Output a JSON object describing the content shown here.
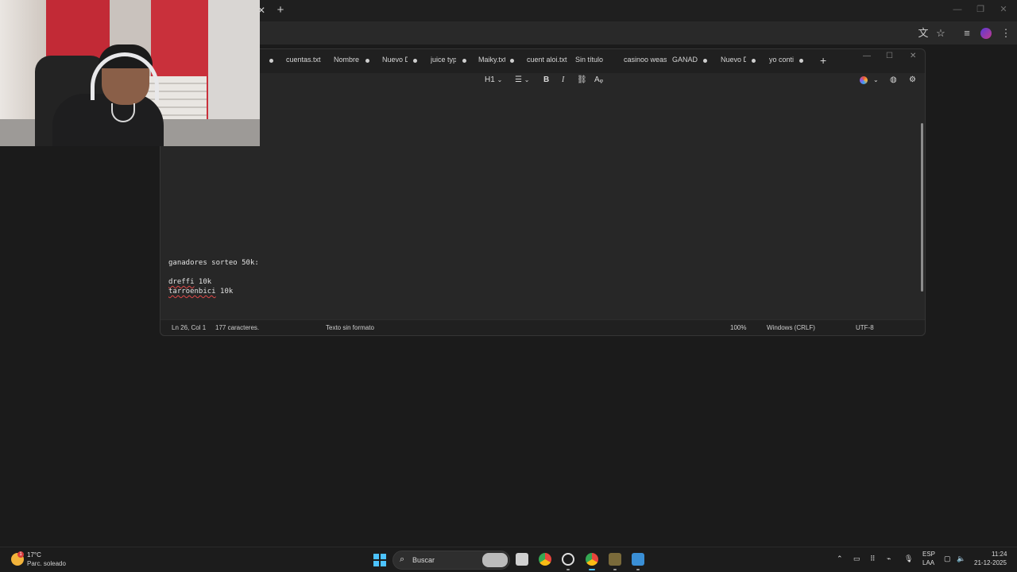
{
  "browser": {
    "new_tab_glyph": "+",
    "close_glyph": "✕"
  },
  "notepad": {
    "tabs": [
      {
        "label": "cuentas.txt",
        "modified": false
      },
      {
        "label": "Nombre",
        "modified": true
      },
      {
        "label": "Nuevo D",
        "modified": true
      },
      {
        "label": "juice typ",
        "modified": true
      },
      {
        "label": "Maiky.txt",
        "modified": true
      },
      {
        "label": "cuent aloi.txt",
        "modified": false
      },
      {
        "label": "Sin título",
        "modified": false
      },
      {
        "label": "casinoo weas.t",
        "modified": false
      },
      {
        "label": "GANADO",
        "modified": true
      },
      {
        "label": "Nuevo D",
        "modified": true
      },
      {
        "label": "yo conti",
        "modified": true
      }
    ],
    "add_tab_glyph": "+",
    "toolbar": {
      "heading": "H1",
      "list_icon": "list-icon",
      "bold": "B",
      "italic": "I",
      "link_icon": "link-icon",
      "clear_format_icon": "clear-format-icon"
    },
    "content": {
      "line1": "ganadores sorteo 50k:",
      "line2_name": "dreffi",
      "line2_amount": " 10k",
      "line3_name": "tarroenbici",
      "line3_amount": " 10k"
    },
    "status": {
      "position": "Ln 26, Col 1",
      "chars": "177 caracteres.",
      "format": "Texto sin formato",
      "zoom": "100%",
      "line_endings": "Windows (CRLF)",
      "encoding": "UTF-8"
    }
  },
  "taskbar": {
    "weather_temp": "17°C",
    "weather_desc": "Parc. soleado",
    "weather_badge": "1",
    "search_label": "Buscar",
    "lang": "ESP",
    "lang_sub": "LAA",
    "time": "11:24",
    "date": "21-12-2025"
  },
  "colors": {
    "accent": "#4cc2ff",
    "spellcheck": "#e04848"
  }
}
